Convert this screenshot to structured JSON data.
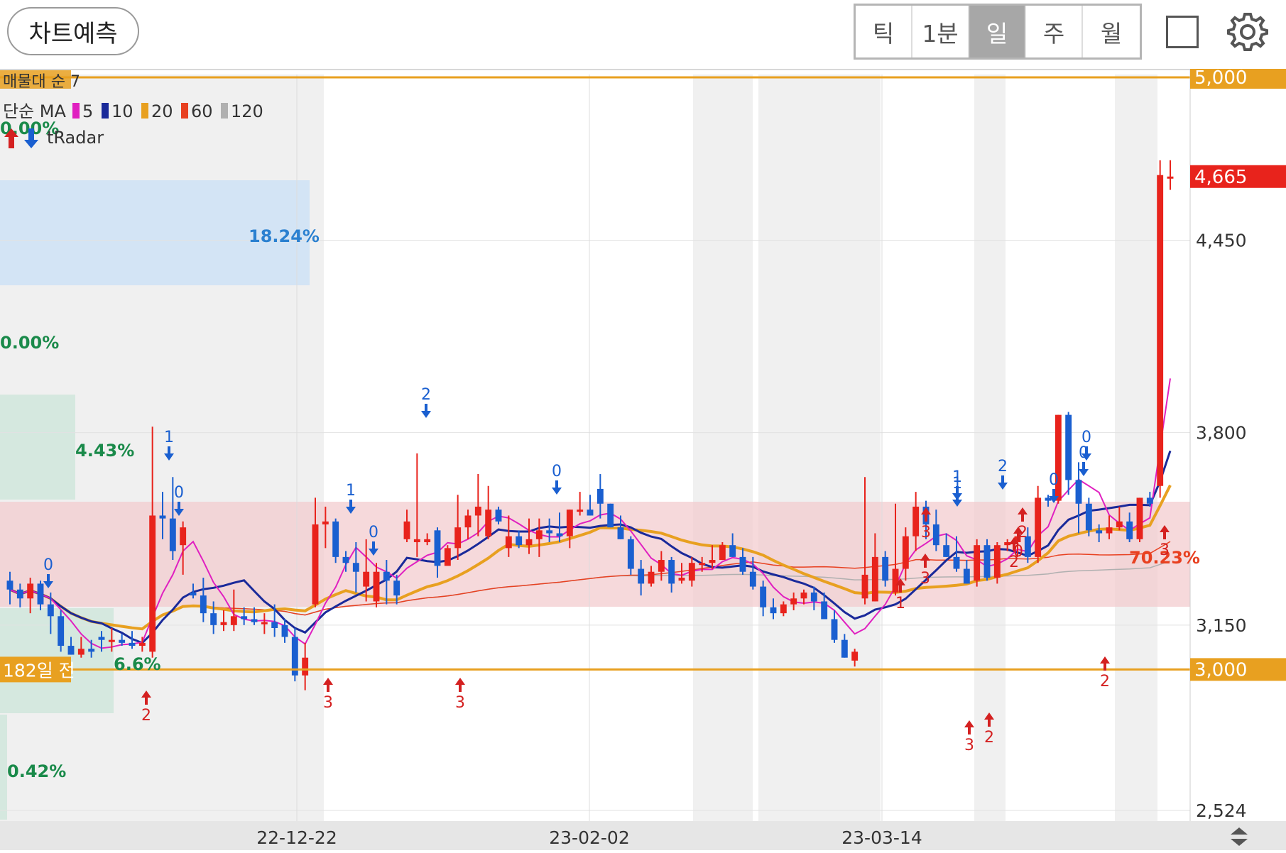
{
  "toolbar": {
    "predict_label": "차트예측",
    "periods": [
      "틱",
      "1분",
      "일",
      "주",
      "월"
    ],
    "active_period": "일"
  },
  "indicators": {
    "volume_profile_label": "매물대 순 7",
    "ma_label": "단순 MA",
    "ma_periods": [
      "5",
      "10",
      "20",
      "60",
      "120"
    ],
    "ma_colors": [
      "#e020c0",
      "#1a2a9a",
      "#e8a020",
      "#e84020",
      "#b0b0b0"
    ],
    "tradar_label": "tRadar"
  },
  "chart_data": {
    "type": "candlestick",
    "period": "daily",
    "x_tick_labels": [
      "22-12-22",
      "23-02-02",
      "23-03-14"
    ],
    "y_tick_labels": [
      "4,450",
      "3,800",
      "3,150",
      "2,524"
    ],
    "ylim": [
      2524,
      5000
    ],
    "reference_lines": [
      {
        "label": "5,000",
        "value": 5000
      },
      {
        "label": "3,000",
        "value": 3000,
        "tag": "182일 전"
      }
    ],
    "current_price": {
      "label": "4,665",
      "value": 4665
    },
    "zone_percent_labels": [
      "18.24%",
      "0.00%",
      "0.00%",
      "4.43%",
      "6.6%",
      "0.42%",
      "70.23%"
    ],
    "signal_labels": [
      "0",
      "1",
      "0",
      "2",
      "3",
      "1",
      "0",
      "3",
      "2",
      "3",
      "2",
      "0",
      "2",
      "0",
      "0",
      "1",
      "3",
      "1",
      "2",
      "0",
      "1",
      "2",
      "3",
      "2",
      "0",
      "3"
    ],
    "colors": {
      "up": "#e8231c",
      "down": "#1a5fd0",
      "ref_line": "#e8a020",
      "current": "#e8231c"
    },
    "candles": [
      [
        3300,
        3330,
        3220,
        3270
      ],
      [
        3270,
        3290,
        3210,
        3240
      ],
      [
        3240,
        3310,
        3190,
        3290
      ],
      [
        3290,
        3300,
        3200,
        3220
      ],
      [
        3220,
        3260,
        3120,
        3180
      ],
      [
        3180,
        3200,
        3060,
        3080
      ],
      [
        3080,
        3110,
        3050,
        3050
      ],
      [
        3050,
        3110,
        3040,
        3070
      ],
      [
        3070,
        3100,
        3040,
        3060
      ],
      [
        3110,
        3130,
        3060,
        3100
      ],
      [
        3100,
        3140,
        3060,
        3100
      ],
      [
        3100,
        3120,
        3080,
        3090
      ],
      [
        3090,
        3130,
        3070,
        3080
      ],
      [
        3080,
        3110,
        3060,
        3090
      ],
      [
        3060,
        3820,
        3040,
        3520
      ],
      [
        3520,
        3600,
        3440,
        3510
      ],
      [
        3510,
        3650,
        3370,
        3400
      ],
      [
        3420,
        3500,
        3320,
        3480
      ],
      [
        3260,
        3290,
        3240,
        3250
      ],
      [
        3250,
        3310,
        3160,
        3190
      ],
      [
        3190,
        3230,
        3120,
        3150
      ],
      [
        3150,
        3200,
        3130,
        3160
      ],
      [
        3150,
        3270,
        3130,
        3180
      ],
      [
        3180,
        3210,
        3150,
        3170
      ],
      [
        3170,
        3210,
        3150,
        3160
      ],
      [
        3160,
        3190,
        3120,
        3160
      ],
      [
        3160,
        3220,
        3110,
        3140
      ],
      [
        3150,
        3170,
        3090,
        3110
      ],
      [
        3110,
        3140,
        2960,
        2980
      ],
      [
        2980,
        3090,
        2930,
        3040
      ],
      [
        3220,
        3580,
        3210,
        3490
      ],
      [
        3490,
        3550,
        3410,
        3500
      ],
      [
        3500,
        3510,
        3360,
        3380
      ],
      [
        3380,
        3400,
        3330,
        3360
      ],
      [
        3360,
        3430,
        3260,
        3330
      ],
      [
        3280,
        3440,
        3230,
        3330
      ],
      [
        3230,
        3360,
        3210,
        3330
      ],
      [
        3330,
        3370,
        3220,
        3300
      ],
      [
        3300,
        3320,
        3220,
        3250
      ],
      [
        3440,
        3540,
        3430,
        3500
      ],
      [
        3430,
        3730,
        3380,
        3440
      ],
      [
        3430,
        3460,
        3420,
        3440
      ],
      [
        3470,
        3480,
        3310,
        3350
      ],
      [
        3350,
        3420,
        3360,
        3410
      ],
      [
        3410,
        3590,
        3370,
        3480
      ],
      [
        3480,
        3540,
        3440,
        3520
      ],
      [
        3520,
        3660,
        3450,
        3550
      ],
      [
        3450,
        3620,
        3440,
        3540
      ],
      [
        3540,
        3550,
        3490,
        3500
      ],
      [
        3410,
        3520,
        3380,
        3450
      ],
      [
        3450,
        3470,
        3410,
        3420
      ],
      [
        3420,
        3510,
        3390,
        3440
      ],
      [
        3440,
        3510,
        3380,
        3470
      ],
      [
        3470,
        3510,
        3430,
        3460
      ],
      [
        3460,
        3530,
        3430,
        3450
      ],
      [
        3450,
        3540,
        3410,
        3540
      ],
      [
        3540,
        3600,
        3520,
        3540
      ],
      [
        3540,
        3590,
        3520,
        3520
      ],
      [
        3610,
        3660,
        3510,
        3560
      ],
      [
        3560,
        3560,
        3480,
        3480
      ],
      [
        3480,
        3520,
        3440,
        3440
      ],
      [
        3440,
        3450,
        3320,
        3340
      ],
      [
        3340,
        3370,
        3250,
        3290
      ],
      [
        3290,
        3350,
        3280,
        3330
      ],
      [
        3330,
        3400,
        3300,
        3370
      ],
      [
        3370,
        3380,
        3260,
        3290
      ],
      [
        3300,
        3360,
        3290,
        3310
      ],
      [
        3300,
        3380,
        3280,
        3360
      ],
      [
        3360,
        3380,
        3330,
        3360
      ],
      [
        3360,
        3420,
        3340,
        3370
      ],
      [
        3370,
        3430,
        3370,
        3420
      ],
      [
        3420,
        3460,
        3380,
        3380
      ],
      [
        3380,
        3410,
        3320,
        3330
      ],
      [
        3330,
        3380,
        3270,
        3280
      ],
      [
        3280,
        3300,
        3180,
        3210
      ],
      [
        3210,
        3240,
        3170,
        3190
      ],
      [
        3190,
        3230,
        3180,
        3220
      ],
      [
        3220,
        3260,
        3200,
        3240
      ],
      [
        3240,
        3270,
        3220,
        3260
      ],
      [
        3260,
        3280,
        3200,
        3230
      ],
      [
        3230,
        3260,
        3170,
        3170
      ],
      [
        3170,
        3200,
        3090,
        3100
      ],
      [
        3100,
        3120,
        3040,
        3040
      ],
      [
        3030,
        3070,
        3010,
        3060
      ],
      [
        3240,
        3650,
        3220,
        3320
      ],
      [
        3230,
        3460,
        3230,
        3380
      ],
      [
        3380,
        3400,
        3280,
        3300
      ],
      [
        3260,
        3560,
        3250,
        3340
      ],
      [
        3340,
        3480,
        3300,
        3450
      ],
      [
        3450,
        3600,
        3400,
        3550
      ],
      [
        3550,
        3570,
        3440,
        3490
      ],
      [
        3490,
        3540,
        3400,
        3420
      ],
      [
        3420,
        3460,
        3380,
        3380
      ],
      [
        3380,
        3450,
        3330,
        3340
      ],
      [
        3340,
        3370,
        3290,
        3290
      ],
      [
        3300,
        3440,
        3280,
        3420
      ],
      [
        3420,
        3440,
        3300,
        3310
      ],
      [
        3310,
        3430,
        3290,
        3420
      ],
      [
        3420,
        3440,
        3400,
        3430
      ],
      [
        3430,
        3470,
        3380,
        3450
      ],
      [
        3450,
        3480,
        3360,
        3380
      ],
      [
        3380,
        3620,
        3360,
        3580
      ],
      [
        3580,
        3590,
        3550,
        3570
      ],
      [
        3570,
        3860,
        3560,
        3860
      ],
      [
        3860,
        3870,
        3590,
        3640
      ],
      [
        3640,
        3700,
        3460,
        3560
      ],
      [
        3560,
        3580,
        3450,
        3470
      ],
      [
        3470,
        3490,
        3430,
        3460
      ],
      [
        3460,
        3520,
        3440,
        3480
      ],
      [
        3480,
        3550,
        3470,
        3500
      ],
      [
        3500,
        3530,
        3430,
        3440
      ],
      [
        3440,
        3580,
        3430,
        3580
      ],
      [
        3580,
        3600,
        3550,
        3560
      ],
      [
        3620,
        4720,
        3580,
        4670
      ],
      [
        4665,
        4720,
        4620,
        4665
      ]
    ]
  }
}
